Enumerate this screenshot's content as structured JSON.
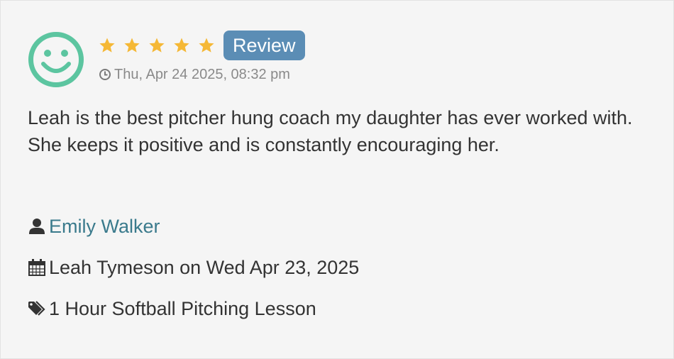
{
  "review": {
    "rating": 5,
    "rating_max": 5,
    "badge_label": "Review",
    "timestamp": "Thu, Apr 24 2025, 08:32 pm",
    "text": "Leah is the best pitcher hung coach my daughter has ever worked with. She keeps it positive and is constantly encouraging her.",
    "reviewer_name": "Emily Walker",
    "booking_info": "Leah Tymeson on Wed Apr 23, 2025",
    "service_name": "1 Hour Softball Pitching Lesson"
  },
  "icons": {
    "avatar": "smiley-face-icon",
    "star": "star-icon",
    "timestamp": "clock-icon",
    "reviewer": "user-icon",
    "booking": "calendar-icon",
    "service": "tags-icon"
  },
  "colors": {
    "background": "#f5f5f5",
    "smiley": "#5cc5a0",
    "star": "#f5b836",
    "badge": "#5b8db5",
    "link": "#3a7a8c",
    "muted": "#8a8a8a",
    "text": "#333333"
  }
}
